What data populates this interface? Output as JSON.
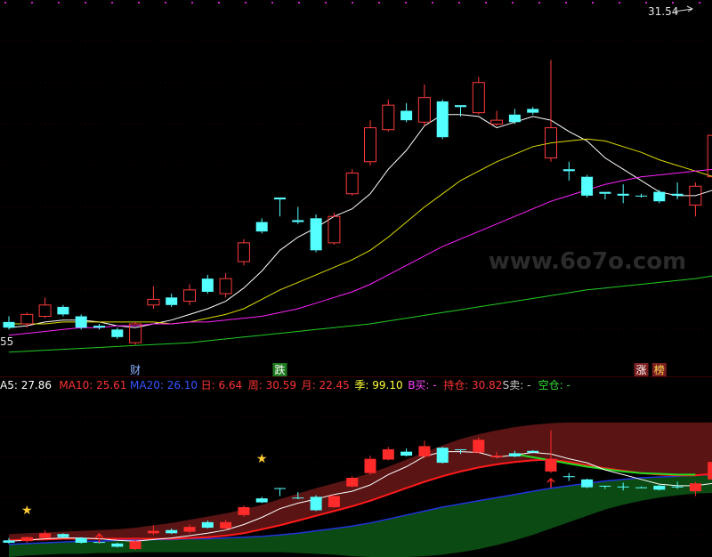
{
  "watermark": "www.6o7o.com",
  "chart_data": [
    {
      "type": "candlestick",
      "price_high_label": "31.54",
      "price_low_label": "55",
      "ylim": [
        13.5,
        32.0
      ],
      "candles": [
        {
          "o": 15.3,
          "c": 15.0,
          "h": 15.6,
          "l": 14.9,
          "up": false
        },
        {
          "o": 15.2,
          "c": 15.7,
          "h": 15.8,
          "l": 15.0,
          "up": true
        },
        {
          "o": 15.6,
          "c": 16.2,
          "h": 16.6,
          "l": 15.5,
          "up": true
        },
        {
          "o": 16.1,
          "c": 15.7,
          "h": 16.2,
          "l": 15.6,
          "up": false
        },
        {
          "o": 15.6,
          "c": 15.0,
          "h": 15.7,
          "l": 14.9,
          "up": false
        },
        {
          "o": 15.0,
          "c": 15.1,
          "h": 15.2,
          "l": 14.9,
          "up": false
        },
        {
          "o": 14.9,
          "c": 14.5,
          "h": 15.0,
          "l": 14.4,
          "up": false
        },
        {
          "o": 14.2,
          "c": 15.2,
          "h": 15.3,
          "l": 14.1,
          "up": true
        },
        {
          "o": 16.2,
          "c": 16.5,
          "h": 17.2,
          "l": 16.0,
          "up": true
        },
        {
          "o": 16.6,
          "c": 16.2,
          "h": 16.8,
          "l": 16.1,
          "up": false
        },
        {
          "o": 16.4,
          "c": 17.0,
          "h": 17.3,
          "l": 16.2,
          "up": true
        },
        {
          "o": 17.6,
          "c": 16.9,
          "h": 17.8,
          "l": 16.8,
          "up": false
        },
        {
          "o": 16.8,
          "c": 17.6,
          "h": 17.9,
          "l": 16.6,
          "up": true
        },
        {
          "o": 18.5,
          "c": 19.5,
          "h": 19.7,
          "l": 18.3,
          "up": true
        },
        {
          "o": 20.6,
          "c": 20.1,
          "h": 20.8,
          "l": 20.0,
          "up": false
        },
        {
          "o": 21.9,
          "c": 21.8,
          "h": 21.9,
          "l": 20.9,
          "up": false
        },
        {
          "o": 20.7,
          "c": 20.6,
          "h": 21.4,
          "l": 20.5,
          "up": false
        },
        {
          "o": 20.8,
          "c": 19.1,
          "h": 21.0,
          "l": 19.0,
          "up": false
        },
        {
          "o": 19.5,
          "c": 20.9,
          "h": 21.1,
          "l": 19.4,
          "up": true
        },
        {
          "o": 22.1,
          "c": 23.2,
          "h": 23.4,
          "l": 22.0,
          "up": true
        },
        {
          "o": 23.8,
          "c": 25.6,
          "h": 26.0,
          "l": 23.6,
          "up": true
        },
        {
          "o": 25.5,
          "c": 26.8,
          "h": 27.1,
          "l": 25.4,
          "up": true
        },
        {
          "o": 26.5,
          "c": 26.0,
          "h": 26.9,
          "l": 25.9,
          "up": false
        },
        {
          "o": 25.9,
          "c": 27.2,
          "h": 27.9,
          "l": 25.7,
          "up": true
        },
        {
          "o": 27.0,
          "c": 25.1,
          "h": 27.1,
          "l": 25.0,
          "up": false
        },
        {
          "o": 26.8,
          "c": 26.7,
          "h": 26.8,
          "l": 26.2,
          "up": false
        },
        {
          "o": 26.4,
          "c": 28.0,
          "h": 28.3,
          "l": 26.3,
          "up": true
        },
        {
          "o": 25.8,
          "c": 26.0,
          "h": 26.5,
          "l": 25.7,
          "up": true
        },
        {
          "o": 26.3,
          "c": 25.9,
          "h": 26.6,
          "l": 25.8,
          "up": false
        },
        {
          "o": 26.6,
          "c": 26.4,
          "h": 26.7,
          "l": 26.3,
          "up": false
        },
        {
          "o": 24.0,
          "c": 25.6,
          "h": 29.2,
          "l": 23.8,
          "up": true
        },
        {
          "o": 23.4,
          "c": 23.3,
          "h": 23.8,
          "l": 22.8,
          "up": false
        },
        {
          "o": 23.0,
          "c": 22.0,
          "h": 23.1,
          "l": 21.9,
          "up": false
        },
        {
          "o": 22.2,
          "c": 22.1,
          "h": 22.2,
          "l": 21.8,
          "up": false
        },
        {
          "o": 22.1,
          "c": 22.0,
          "h": 22.6,
          "l": 21.6,
          "up": false
        },
        {
          "o": 22.0,
          "c": 22.0,
          "h": 22.1,
          "l": 21.9,
          "up": false
        },
        {
          "o": 22.2,
          "c": 21.7,
          "h": 22.3,
          "l": 21.6,
          "up": false
        },
        {
          "o": 22.1,
          "c": 22.0,
          "h": 22.7,
          "l": 21.8,
          "up": false
        },
        {
          "o": 21.5,
          "c": 22.5,
          "h": 22.7,
          "l": 20.9,
          "up": true
        },
        {
          "o": 23.0,
          "c": 25.2,
          "h": 25.3,
          "l": 22.8,
          "up": true
        },
        {
          "o": 26.0,
          "c": 28.0,
          "h": 29.0,
          "l": 25.8,
          "up": true
        },
        {
          "o": 28.4,
          "c": 28.8,
          "h": 29.0,
          "l": 27.8,
          "up": true
        },
        {
          "o": 28.6,
          "c": 31.5,
          "h": 32.0,
          "l": 28.5,
          "up": true
        }
      ],
      "ma_lines": [
        {
          "name": "MA5",
          "color": "#ffffff",
          "values": [
            15.0,
            15.1,
            15.3,
            15.4,
            15.4,
            15.3,
            15.1,
            15.0,
            15.2,
            15.4,
            15.7,
            16.0,
            16.4,
            17.1,
            18.0,
            19.1,
            19.8,
            20.3,
            20.9,
            21.3,
            22.1,
            23.4,
            24.4,
            25.7,
            26.3,
            26.3,
            26.2,
            25.6,
            25.9,
            26.2,
            26.0,
            25.4,
            24.9,
            24.0,
            23.4,
            22.8,
            22.2,
            22.0,
            22.0,
            22.3,
            23.1,
            24.2,
            25.7
          ]
        },
        {
          "name": "MA10",
          "color": "#dddd00",
          "values": [
            15.2,
            15.2,
            15.2,
            15.3,
            15.3,
            15.3,
            15.3,
            15.3,
            15.3,
            15.2,
            15.3,
            15.5,
            15.7,
            16.0,
            16.5,
            17.0,
            17.4,
            17.8,
            18.2,
            18.6,
            19.1,
            19.8,
            20.6,
            21.4,
            22.1,
            22.8,
            23.3,
            23.8,
            24.2,
            24.6,
            24.8,
            24.9,
            25.0,
            24.9,
            24.6,
            24.3,
            23.9,
            23.6,
            23.3,
            23.0,
            22.8,
            22.9,
            23.2
          ]
        },
        {
          "name": "MA20",
          "color": "#ff22ff",
          "values": [
            14.6,
            14.7,
            14.8,
            14.9,
            15.0,
            15.0,
            15.1,
            15.1,
            15.2,
            15.2,
            15.3,
            15.3,
            15.4,
            15.5,
            15.6,
            15.8,
            16.0,
            16.3,
            16.6,
            16.9,
            17.3,
            17.8,
            18.3,
            18.8,
            19.3,
            19.7,
            20.1,
            20.5,
            20.9,
            21.3,
            21.7,
            22.0,
            22.3,
            22.6,
            22.8,
            23.0,
            23.1,
            23.2,
            23.3,
            23.4,
            23.6,
            23.9,
            24.3
          ]
        },
        {
          "name": "MA60",
          "color": "#22cc22",
          "values": [
            13.7,
            13.75,
            13.8,
            13.85,
            13.9,
            13.95,
            14.0,
            14.05,
            14.1,
            14.15,
            14.2,
            14.3,
            14.4,
            14.5,
            14.6,
            14.7,
            14.8,
            14.9,
            15.0,
            15.1,
            15.2,
            15.35,
            15.5,
            15.65,
            15.8,
            15.95,
            16.1,
            16.25,
            16.4,
            16.55,
            16.7,
            16.85,
            17.0,
            17.1,
            17.2,
            17.3,
            17.4,
            17.5,
            17.6,
            17.75,
            17.9,
            18.05,
            18.2
          ]
        }
      ],
      "event_markers": [
        {
          "text": "财",
          "color": "#8ab4ff",
          "index": 7
        },
        {
          "text": "跌",
          "color": "#ffffff",
          "bg": "#1f7a1f",
          "index": 15
        },
        {
          "text": "涨",
          "color": "#ffffff",
          "bg": "#7a1f1f",
          "index": 35
        },
        {
          "text": "榜",
          "color": "#ffdd55",
          "bg": "#7a1f1f",
          "index": 36
        }
      ]
    },
    {
      "type": "indicator",
      "legend": [
        {
          "text": "A5: 27.86",
          "color": "#ffffff"
        },
        {
          "text": "MA10: 25.61",
          "color": "#ff3333"
        },
        {
          "text": "MA20: 26.10",
          "color": "#3355ff"
        },
        {
          "text": "日: 6.64",
          "color": "#ff3333"
        },
        {
          "text": "周: 30.59",
          "color": "#ff3333"
        },
        {
          "text": "月: 22.45",
          "color": "#ff3333"
        },
        {
          "text": "季: 99.10",
          "color": "#ffff33"
        },
        {
          "text": "B买: -",
          "color": "#ff44ff"
        },
        {
          "text": "持仓: 30.82",
          "color": "#ff3333"
        },
        {
          "text": "S卖: -",
          "color": "#cccccc"
        },
        {
          "text": "空仓: -",
          "color": "#33dd33"
        }
      ],
      "ylim": [
        13.0,
        33.0
      ],
      "band_upper": [
        15.9,
        16.0,
        16.1,
        16.2,
        16.3,
        16.4,
        16.5,
        16.7,
        17.0,
        17.3,
        17.7,
        18.1,
        18.5,
        19.0,
        19.6,
        20.3,
        21.0,
        21.7,
        22.3,
        22.9,
        23.6,
        24.4,
        25.3,
        26.2,
        27.1,
        27.9,
        28.5,
        29.0,
        29.4,
        29.7,
        29.9,
        30.0,
        30.0,
        30.0,
        30.0,
        30.0,
        30.0,
        30.0,
        30.0,
        30.0,
        30.0,
        30.0,
        30.0
      ],
      "band_lower": [
        13.0,
        13.2,
        13.3,
        13.4,
        13.4,
        13.5,
        13.5,
        13.6,
        13.6,
        13.6,
        13.6,
        13.6,
        13.6,
        13.6,
        13.6,
        13.6,
        13.5,
        13.4,
        13.3,
        13.1,
        13.0,
        13.0,
        13.0,
        13.1,
        13.3,
        13.6,
        14.0,
        14.5,
        15.1,
        15.8,
        16.6,
        17.4,
        18.2,
        19.0,
        19.6,
        20.1,
        20.5,
        20.8,
        21.0,
        21.1,
        21.2,
        21.3,
        21.4
      ],
      "line_white": [
        15.0,
        15.1,
        15.3,
        15.4,
        15.4,
        15.3,
        15.1,
        15.0,
        15.2,
        15.4,
        15.7,
        16.0,
        16.4,
        17.1,
        18.0,
        19.1,
        19.8,
        20.3,
        20.9,
        21.3,
        22.1,
        23.4,
        24.4,
        25.7,
        26.3,
        26.3,
        26.2,
        25.6,
        25.9,
        26.2,
        26.0,
        25.4,
        24.9,
        24.0,
        23.4,
        22.8,
        22.2,
        22.0,
        22.0,
        22.3,
        23.1,
        24.2,
        25.7
      ],
      "line_red": [
        15.1,
        15.2,
        15.2,
        15.3,
        15.3,
        15.3,
        15.3,
        15.3,
        15.3,
        15.3,
        15.4,
        15.5,
        15.7,
        16.0,
        16.5,
        17.0,
        17.6,
        18.2,
        18.8,
        19.4,
        20.1,
        20.9,
        21.7,
        22.5,
        23.2,
        23.8,
        24.3,
        24.7,
        25.0,
        25.2,
        25.3,
        25.0,
        24.6,
        24.2,
        23.9,
        23.6,
        23.4,
        23.3,
        23.3,
        23.5,
        23.8,
        24.2,
        24.7
      ],
      "line_blue": [
        14.6,
        14.7,
        14.8,
        14.9,
        15.0,
        15.0,
        15.1,
        15.1,
        15.2,
        15.2,
        15.3,
        15.3,
        15.4,
        15.5,
        15.6,
        15.8,
        16.0,
        16.3,
        16.6,
        16.9,
        17.3,
        17.8,
        18.3,
        18.8,
        19.3,
        19.7,
        20.1,
        20.5,
        20.9,
        21.3,
        21.7,
        22.0,
        22.3,
        22.6,
        22.8,
        23.0,
        23.1,
        23.2,
        23.3,
        23.4,
        23.6,
        23.9,
        24.3
      ],
      "line_green_segment": {
        "start": 28,
        "values": [
          26.0,
          25.6,
          25.2,
          24.8,
          24.4,
          24.1,
          23.8,
          23.6,
          23.5,
          23.4,
          23.4
        ]
      },
      "markers": [
        {
          "type": "star",
          "index": 1,
          "color": "#ffcc33"
        },
        {
          "type": "star",
          "index": 14,
          "color": "#ffcc33"
        },
        {
          "type": "arrow-up",
          "index": 5,
          "color": "#ff2222"
        },
        {
          "type": "arrow-up",
          "index": 30,
          "color": "#ff2222"
        }
      ]
    }
  ]
}
